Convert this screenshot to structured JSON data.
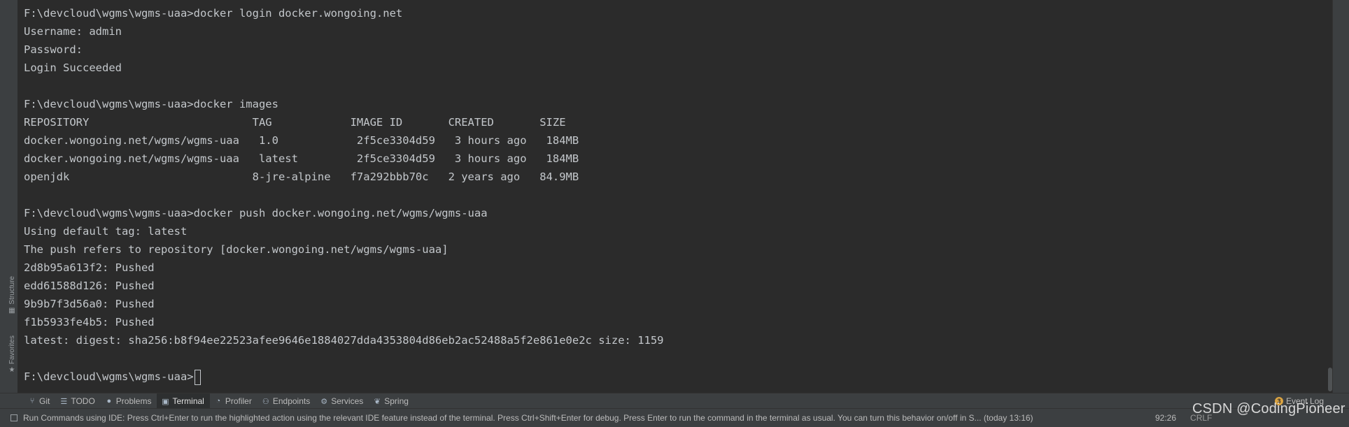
{
  "terminal": {
    "lines": [
      "F:\\devcloud\\wgms\\wgms-uaa>docker login docker.wongoing.net",
      "Username: admin",
      "Password:",
      "Login Succeeded",
      "",
      "F:\\devcloud\\wgms\\wgms-uaa>docker images",
      "REPOSITORY                         TAG            IMAGE ID       CREATED       SIZE",
      "docker.wongoing.net/wgms/wgms-uaa   1.0            2f5ce3304d59   3 hours ago   184MB",
      "docker.wongoing.net/wgms/wgms-uaa   latest         2f5ce3304d59   3 hours ago   184MB",
      "openjdk                            8-jre-alpine   f7a292bbb70c   2 years ago   84.9MB",
      "",
      "F:\\devcloud\\wgms\\wgms-uaa>docker push docker.wongoing.net/wgms/wgms-uaa",
      "Using default tag: latest",
      "The push refers to repository [docker.wongoing.net/wgms/wgms-uaa]",
      "2d8b95a613f2: Pushed",
      "edd61588d126: Pushed",
      "9b9b7f3d56a0: Pushed",
      "f1b5933fe4b5: Pushed",
      "latest: digest: sha256:b8f94ee22523afee9646e1884027dda4353804d86eb2ac52488a5f2e861e0e2c size: 1159",
      ""
    ],
    "prompt": "F:\\devcloud\\wgms\\wgms-uaa>"
  },
  "side_tabs": {
    "structure": "Structure",
    "favorites": "Favorites"
  },
  "toolwindows": [
    {
      "name": "git",
      "label": "Git",
      "icon": "branch-icon"
    },
    {
      "name": "todo",
      "label": "TODO",
      "icon": "list-icon"
    },
    {
      "name": "problems",
      "label": "Problems",
      "icon": "info-icon"
    },
    {
      "name": "terminal",
      "label": "Terminal",
      "icon": "terminal-icon",
      "active": true
    },
    {
      "name": "profiler",
      "label": "Profiler",
      "icon": "profiler-icon"
    },
    {
      "name": "endpoints",
      "label": "Endpoints",
      "icon": "endpoints-icon"
    },
    {
      "name": "services",
      "label": "Services",
      "icon": "services-icon"
    },
    {
      "name": "spring",
      "label": "Spring",
      "icon": "spring-icon"
    }
  ],
  "event_log": {
    "label": "Event Log",
    "count": "3"
  },
  "status": {
    "message": "Run Commands using IDE: Press Ctrl+Enter to run the highlighted action using the relevant IDE feature instead of the terminal. Press Ctrl+Shift+Enter for debug. Press Enter to run the command in the terminal as usual. You can turn this behavior on/off in S... (today 13:16)",
    "position": "92:26",
    "line_sep": "CRLF"
  },
  "watermark": "CSDN @CodingPioneer",
  "colors": {
    "background": "#2b2b2b",
    "text": "#c3c7cb",
    "panel": "#3c3f41",
    "badge": "#d9a343"
  }
}
